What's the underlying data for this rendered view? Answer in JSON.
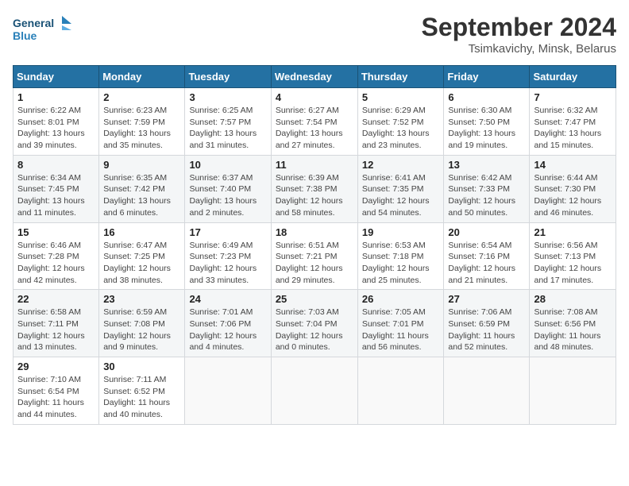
{
  "header": {
    "logo_line1": "General",
    "logo_line2": "Blue",
    "month": "September 2024",
    "location": "Tsimkavichy, Minsk, Belarus"
  },
  "weekdays": [
    "Sunday",
    "Monday",
    "Tuesday",
    "Wednesday",
    "Thursday",
    "Friday",
    "Saturday"
  ],
  "weeks": [
    [
      {
        "day": "1",
        "sunrise": "Sunrise: 6:22 AM",
        "sunset": "Sunset: 8:01 PM",
        "daylight": "Daylight: 13 hours and 39 minutes."
      },
      {
        "day": "2",
        "sunrise": "Sunrise: 6:23 AM",
        "sunset": "Sunset: 7:59 PM",
        "daylight": "Daylight: 13 hours and 35 minutes."
      },
      {
        "day": "3",
        "sunrise": "Sunrise: 6:25 AM",
        "sunset": "Sunset: 7:57 PM",
        "daylight": "Daylight: 13 hours and 31 minutes."
      },
      {
        "day": "4",
        "sunrise": "Sunrise: 6:27 AM",
        "sunset": "Sunset: 7:54 PM",
        "daylight": "Daylight: 13 hours and 27 minutes."
      },
      {
        "day": "5",
        "sunrise": "Sunrise: 6:29 AM",
        "sunset": "Sunset: 7:52 PM",
        "daylight": "Daylight: 13 hours and 23 minutes."
      },
      {
        "day": "6",
        "sunrise": "Sunrise: 6:30 AM",
        "sunset": "Sunset: 7:50 PM",
        "daylight": "Daylight: 13 hours and 19 minutes."
      },
      {
        "day": "7",
        "sunrise": "Sunrise: 6:32 AM",
        "sunset": "Sunset: 7:47 PM",
        "daylight": "Daylight: 13 hours and 15 minutes."
      }
    ],
    [
      {
        "day": "8",
        "sunrise": "Sunrise: 6:34 AM",
        "sunset": "Sunset: 7:45 PM",
        "daylight": "Daylight: 13 hours and 11 minutes."
      },
      {
        "day": "9",
        "sunrise": "Sunrise: 6:35 AM",
        "sunset": "Sunset: 7:42 PM",
        "daylight": "Daylight: 13 hours and 6 minutes."
      },
      {
        "day": "10",
        "sunrise": "Sunrise: 6:37 AM",
        "sunset": "Sunset: 7:40 PM",
        "daylight": "Daylight: 13 hours and 2 minutes."
      },
      {
        "day": "11",
        "sunrise": "Sunrise: 6:39 AM",
        "sunset": "Sunset: 7:38 PM",
        "daylight": "Daylight: 12 hours and 58 minutes."
      },
      {
        "day": "12",
        "sunrise": "Sunrise: 6:41 AM",
        "sunset": "Sunset: 7:35 PM",
        "daylight": "Daylight: 12 hours and 54 minutes."
      },
      {
        "day": "13",
        "sunrise": "Sunrise: 6:42 AM",
        "sunset": "Sunset: 7:33 PM",
        "daylight": "Daylight: 12 hours and 50 minutes."
      },
      {
        "day": "14",
        "sunrise": "Sunrise: 6:44 AM",
        "sunset": "Sunset: 7:30 PM",
        "daylight": "Daylight: 12 hours and 46 minutes."
      }
    ],
    [
      {
        "day": "15",
        "sunrise": "Sunrise: 6:46 AM",
        "sunset": "Sunset: 7:28 PM",
        "daylight": "Daylight: 12 hours and 42 minutes."
      },
      {
        "day": "16",
        "sunrise": "Sunrise: 6:47 AM",
        "sunset": "Sunset: 7:25 PM",
        "daylight": "Daylight: 12 hours and 38 minutes."
      },
      {
        "day": "17",
        "sunrise": "Sunrise: 6:49 AM",
        "sunset": "Sunset: 7:23 PM",
        "daylight": "Daylight: 12 hours and 33 minutes."
      },
      {
        "day": "18",
        "sunrise": "Sunrise: 6:51 AM",
        "sunset": "Sunset: 7:21 PM",
        "daylight": "Daylight: 12 hours and 29 minutes."
      },
      {
        "day": "19",
        "sunrise": "Sunrise: 6:53 AM",
        "sunset": "Sunset: 7:18 PM",
        "daylight": "Daylight: 12 hours and 25 minutes."
      },
      {
        "day": "20",
        "sunrise": "Sunrise: 6:54 AM",
        "sunset": "Sunset: 7:16 PM",
        "daylight": "Daylight: 12 hours and 21 minutes."
      },
      {
        "day": "21",
        "sunrise": "Sunrise: 6:56 AM",
        "sunset": "Sunset: 7:13 PM",
        "daylight": "Daylight: 12 hours and 17 minutes."
      }
    ],
    [
      {
        "day": "22",
        "sunrise": "Sunrise: 6:58 AM",
        "sunset": "Sunset: 7:11 PM",
        "daylight": "Daylight: 12 hours and 13 minutes."
      },
      {
        "day": "23",
        "sunrise": "Sunrise: 6:59 AM",
        "sunset": "Sunset: 7:08 PM",
        "daylight": "Daylight: 12 hours and 9 minutes."
      },
      {
        "day": "24",
        "sunrise": "Sunrise: 7:01 AM",
        "sunset": "Sunset: 7:06 PM",
        "daylight": "Daylight: 12 hours and 4 minutes."
      },
      {
        "day": "25",
        "sunrise": "Sunrise: 7:03 AM",
        "sunset": "Sunset: 7:04 PM",
        "daylight": "Daylight: 12 hours and 0 minutes."
      },
      {
        "day": "26",
        "sunrise": "Sunrise: 7:05 AM",
        "sunset": "Sunset: 7:01 PM",
        "daylight": "Daylight: 11 hours and 56 minutes."
      },
      {
        "day": "27",
        "sunrise": "Sunrise: 7:06 AM",
        "sunset": "Sunset: 6:59 PM",
        "daylight": "Daylight: 11 hours and 52 minutes."
      },
      {
        "day": "28",
        "sunrise": "Sunrise: 7:08 AM",
        "sunset": "Sunset: 6:56 PM",
        "daylight": "Daylight: 11 hours and 48 minutes."
      }
    ],
    [
      {
        "day": "29",
        "sunrise": "Sunrise: 7:10 AM",
        "sunset": "Sunset: 6:54 PM",
        "daylight": "Daylight: 11 hours and 44 minutes."
      },
      {
        "day": "30",
        "sunrise": "Sunrise: 7:11 AM",
        "sunset": "Sunset: 6:52 PM",
        "daylight": "Daylight: 11 hours and 40 minutes."
      },
      null,
      null,
      null,
      null,
      null
    ]
  ]
}
